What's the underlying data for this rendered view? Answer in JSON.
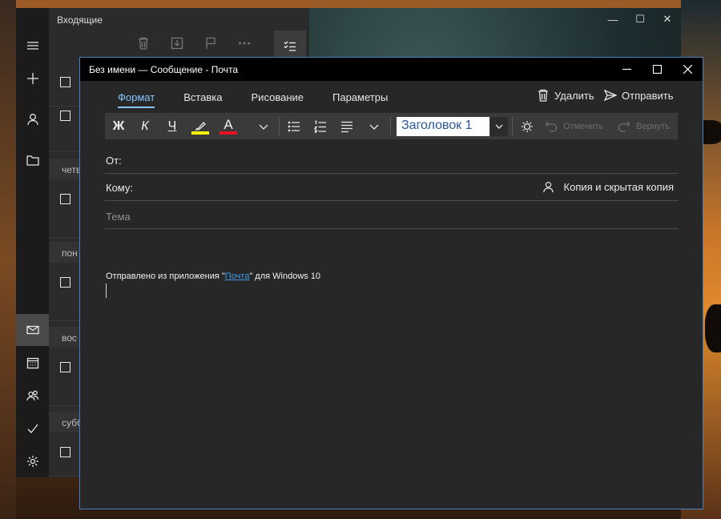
{
  "background_window": {
    "folder_title": "Входящие",
    "date_separators": [
      "четв",
      "пон",
      "вос",
      "субб"
    ],
    "caption": {
      "minimize": "—",
      "maximize": "☐",
      "close": "✕"
    }
  },
  "compose": {
    "window_title": "Без имени — Сообщение - Почта",
    "tabs": [
      {
        "label": "Формат",
        "active": true
      },
      {
        "label": "Вставка",
        "active": false
      },
      {
        "label": "Рисование",
        "active": false
      },
      {
        "label": "Параметры",
        "active": false
      }
    ],
    "commands": {
      "delete_label": "Удалить",
      "send_label": "Отправить"
    },
    "format_toolbar": {
      "bold": "Ж",
      "italic": "К",
      "underline": "Ч",
      "font_color_letter": "A",
      "style_value": "Заголовок 1",
      "undo_label": "Отменить",
      "redo_label": "Вернуть"
    },
    "colors": {
      "accent": "#86c3ff",
      "highlight": "#fff200",
      "font_color": "#e81123",
      "window_border": "#4a7fbf"
    },
    "fields": {
      "from_label": "От:",
      "to_label": "Кому:",
      "cc_bcc_label": "Копия и скрытая копия",
      "subject_placeholder": "Тема"
    },
    "body": {
      "prefix": "Отправлено из приложения \"",
      "link_text": "Почта",
      "suffix": "\" для Windows 10"
    }
  }
}
